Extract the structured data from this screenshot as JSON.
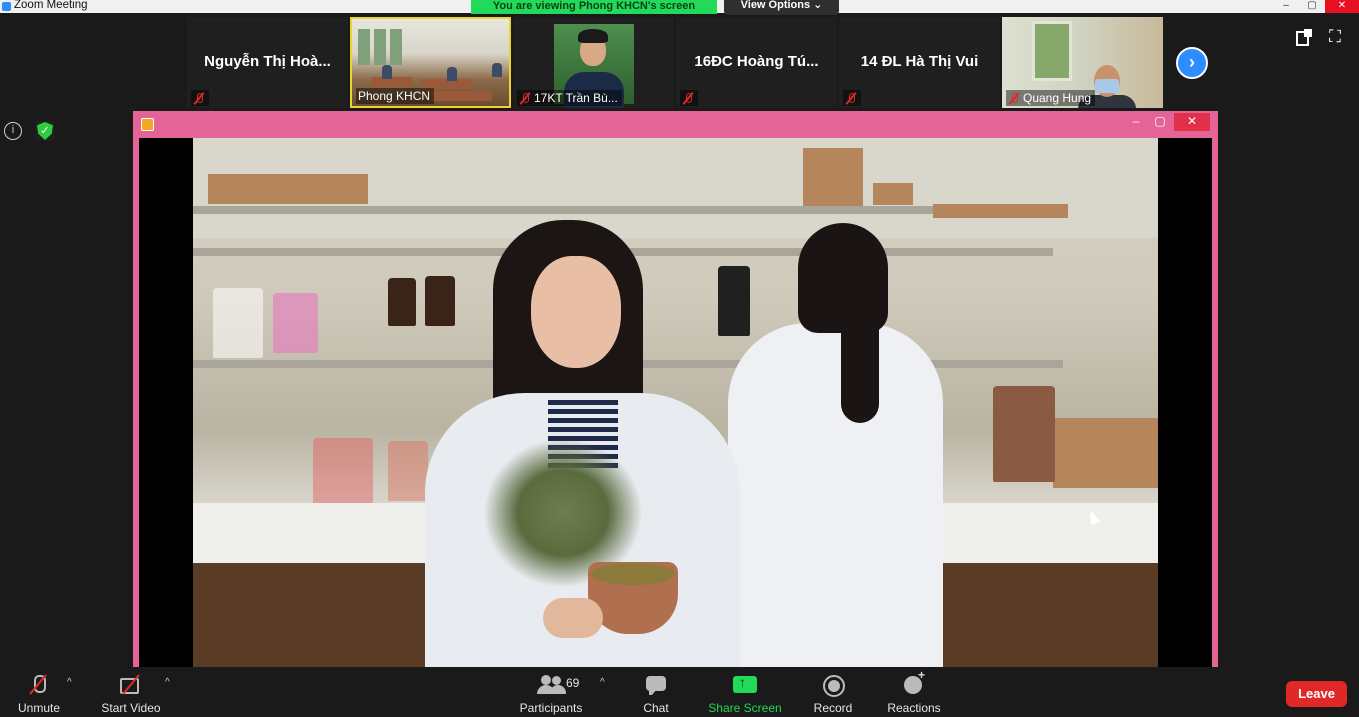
{
  "window": {
    "title": "Zoom Meeting"
  },
  "banner": {
    "viewing_text": "You are viewing Phong KHCN's screen",
    "view_options": "View Options ⌄"
  },
  "gallery": {
    "tiles": [
      {
        "name": "Nguyễn Thị Hoà...",
        "label": ""
      },
      {
        "name": "",
        "label": "Phong KHCN"
      },
      {
        "name": "",
        "label": "17KT Trần Bù..."
      },
      {
        "name": "16ĐC Hoàng Tú...",
        "label": ""
      },
      {
        "name": "14 ĐL Hà Thị Vui",
        "label": ""
      },
      {
        "name": "",
        "label": "Quang Hung"
      }
    ],
    "next_arrow": "›"
  },
  "side": {
    "info": "i",
    "shield": "✓",
    "fullscreen": "⛶"
  },
  "share_window": {
    "min": "–",
    "max": "▢",
    "close": "✕"
  },
  "toolbar": {
    "unmute": "Unmute",
    "start_video": "Start Video",
    "participants": "Participants",
    "participant_count": "69",
    "chat": "Chat",
    "share_screen": "Share Screen",
    "record": "Record",
    "reactions": "Reactions",
    "leave": "Leave",
    "caret": "^"
  },
  "colors": {
    "accent": "#2d8cff",
    "green": "#23d959",
    "leave": "#e02828",
    "share_frame": "#e56497"
  }
}
